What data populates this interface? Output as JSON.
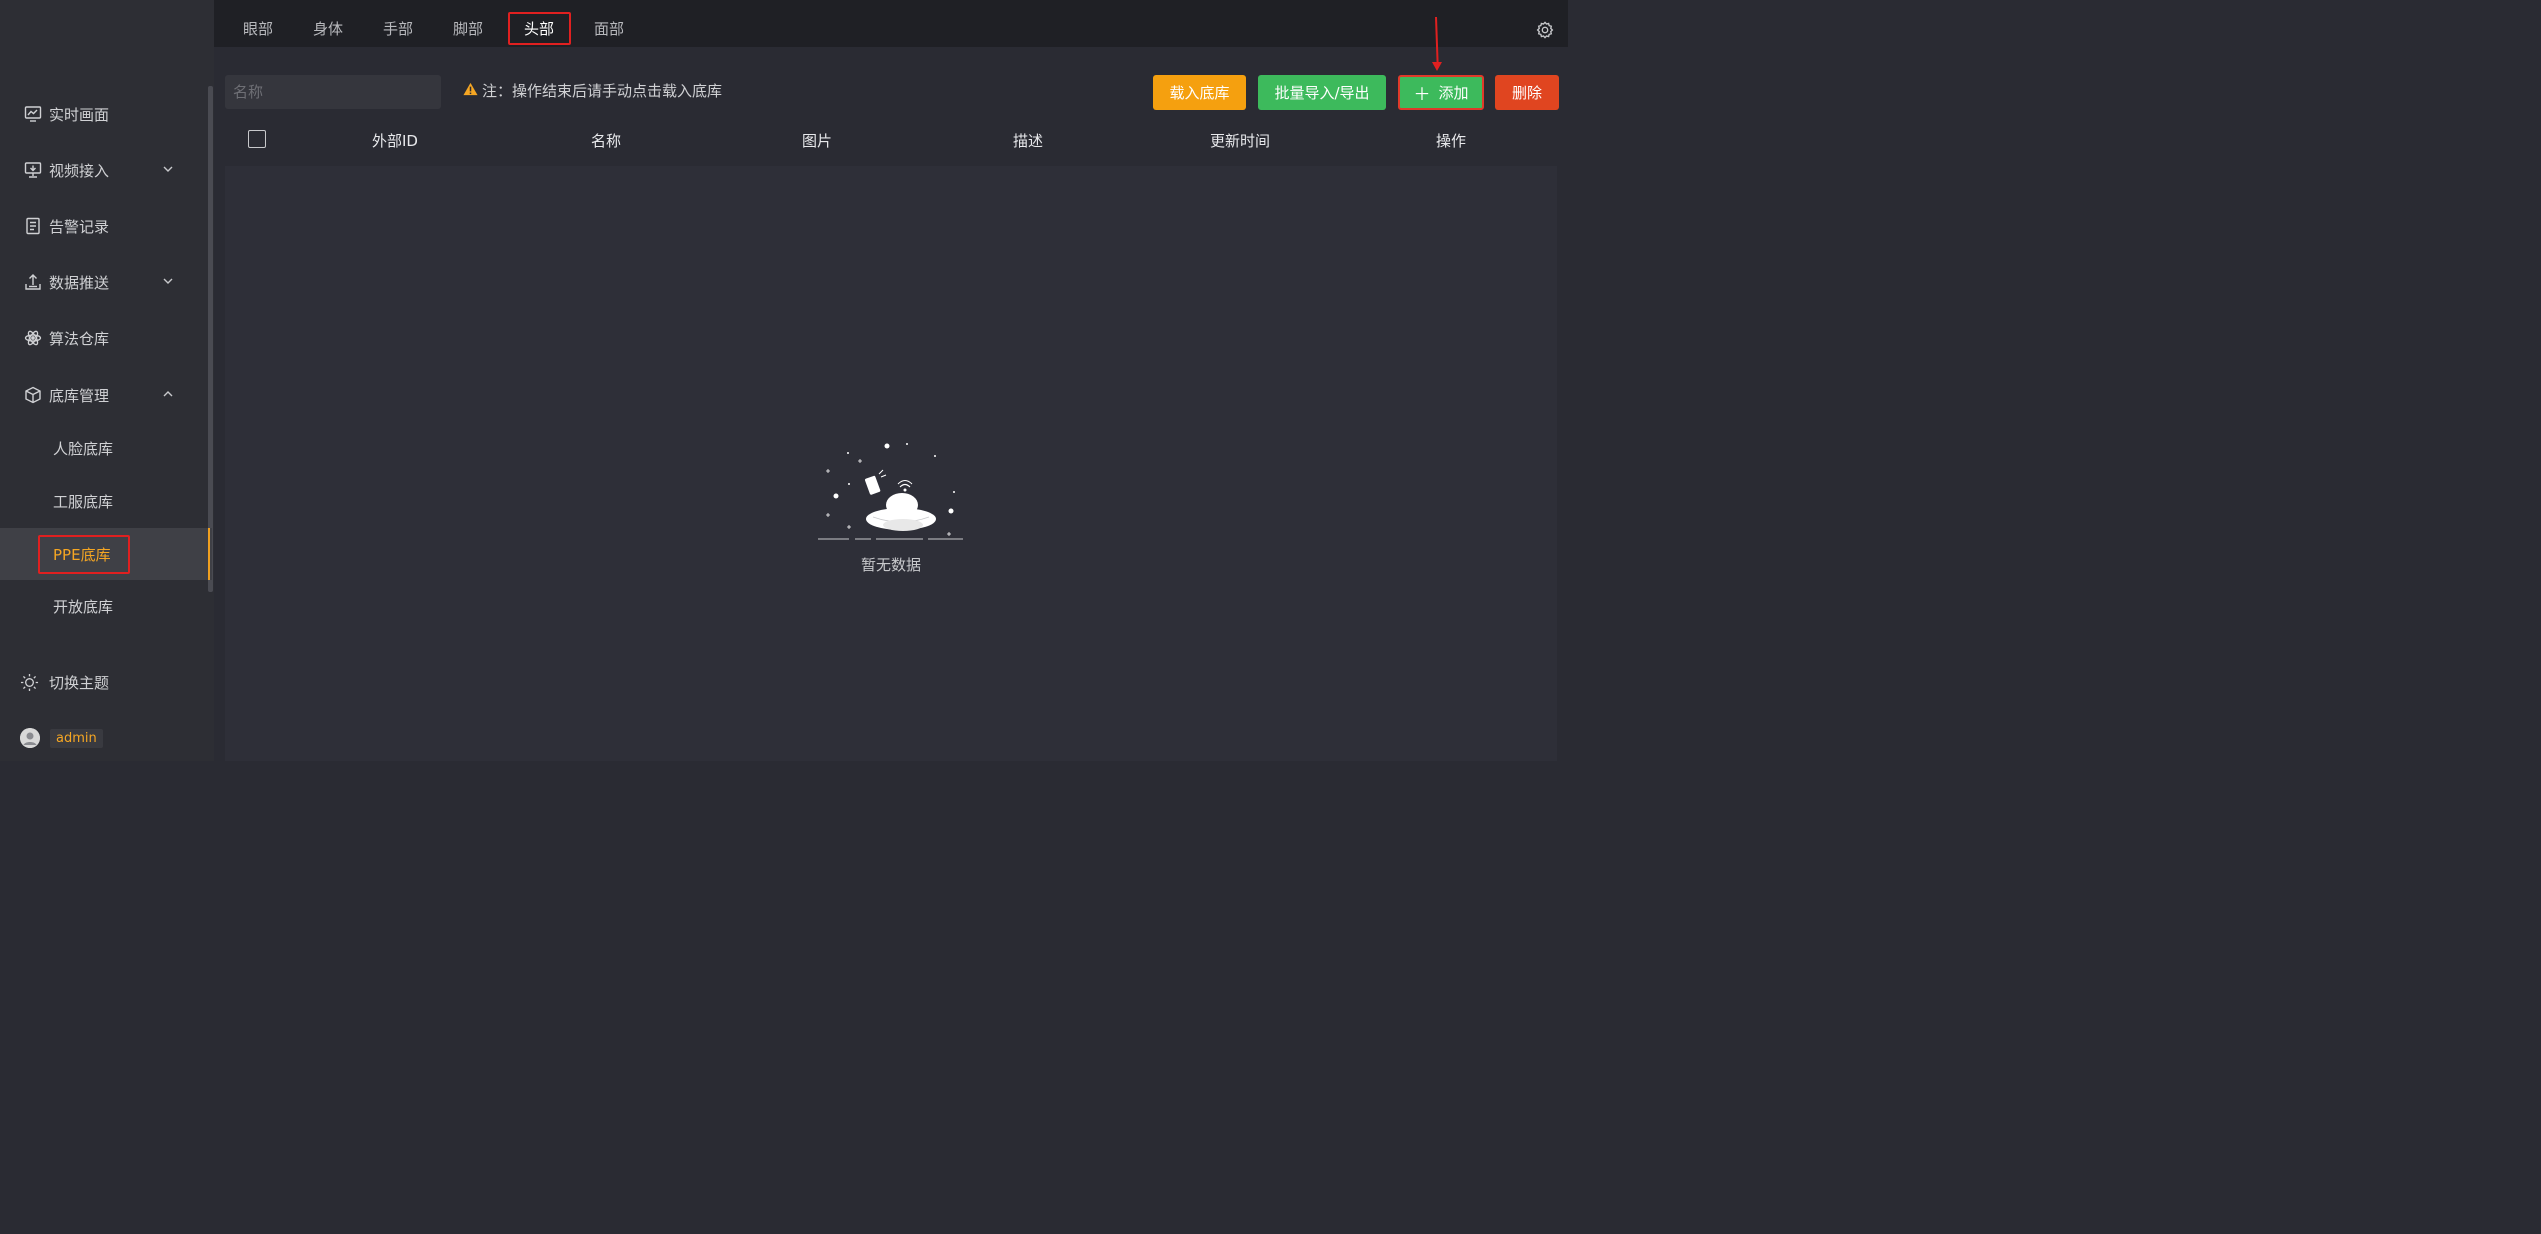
{
  "sidebar": {
    "items": [
      {
        "label": "实时画面",
        "icon": "monitor-chart-icon"
      },
      {
        "label": "视频接入",
        "icon": "video-input-icon",
        "expandable": true
      },
      {
        "label": "告警记录",
        "icon": "list-icon"
      },
      {
        "label": "数据推送",
        "icon": "upload-icon",
        "expandable": true
      },
      {
        "label": "算法仓库",
        "icon": "atom-icon"
      },
      {
        "label": "底库管理",
        "icon": "cube-icon",
        "expanded": true
      }
    ],
    "sub_items": [
      {
        "label": "人脸底库"
      },
      {
        "label": "工服底库"
      },
      {
        "label": "PPE底库",
        "active": true
      },
      {
        "label": "开放底库"
      }
    ],
    "theme_label": "切换主题",
    "username": "admin"
  },
  "tabs": [
    {
      "label": "眼部"
    },
    {
      "label": "身体"
    },
    {
      "label": "手部"
    },
    {
      "label": "脚部"
    },
    {
      "label": "头部",
      "active": true
    },
    {
      "label": "面部"
    }
  ],
  "toolbar": {
    "search_placeholder": "名称",
    "note": "注：操作结束后请手动点击载入底库",
    "load_label": "载入底库",
    "batch_label": "批量导入/导出",
    "add_label": "添加",
    "delete_label": "删除"
  },
  "table": {
    "columns": [
      "外部ID",
      "名称",
      "图片",
      "描述",
      "更新时间",
      "操作"
    ],
    "rows": [],
    "empty_text": "暂无数据"
  },
  "colors": {
    "accent": "#f5a623",
    "green": "#3dba5c",
    "danger": "#e04520",
    "highlight": "#e02020"
  }
}
